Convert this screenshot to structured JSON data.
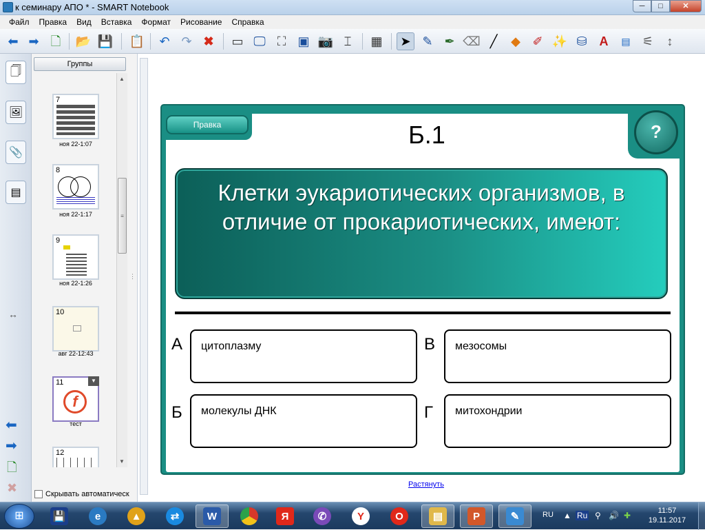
{
  "window": {
    "title": "к семинару АПО * - SMART Notebook",
    "minimize": "─",
    "maximize": "□",
    "close": "✕"
  },
  "menu": [
    "Файл",
    "Правка",
    "Вид",
    "Вставка",
    "Формат",
    "Рисование",
    "Справка"
  ],
  "toolbar_icons": [
    "back-arrow-icon",
    "forward-arrow-icon",
    "add-page-icon",
    "open-folder-icon",
    "save-icon",
    "paste-icon",
    "undo-icon",
    "redo-icon",
    "delete-icon",
    "screen-shade-icon",
    "show-screen-icon",
    "full-screen-icon",
    "dual-page-icon",
    "capture-icon",
    "table-icon",
    "select-icon",
    "pen-icon",
    "creative-pen-icon",
    "eraser-icon",
    "line-icon",
    "shapes-icon",
    "fill-icon",
    "magic-pen-icon",
    "fill-bucket-icon",
    "text-icon",
    "properties-icon",
    "measure-icon",
    "move-toolbar-icon"
  ],
  "sorter": {
    "groups_button": "Группы",
    "autohide_label": "Скрывать автоматическ",
    "pages": [
      {
        "number": "7",
        "caption": "ноя 22-1:07"
      },
      {
        "number": "8",
        "caption": "ноя 22-1:17"
      },
      {
        "number": "9",
        "caption": "ноя 22-1:26"
      },
      {
        "number": "10",
        "caption": "авг 22-12:43"
      },
      {
        "number": "11",
        "caption": "тест"
      },
      {
        "number": "12",
        "caption": ""
      }
    ]
  },
  "slide": {
    "edit_tab": "Правка",
    "help_symbol": "?",
    "title": "Б.1",
    "question": "Клетки эукариотических организмов, в отличие от прокариотических, имеют:",
    "answers": [
      {
        "letter": "А",
        "text": "цитоплазму"
      },
      {
        "letter": "В",
        "text": "мезосомы"
      },
      {
        "letter": "Б",
        "text": "молекулы ДНК"
      },
      {
        "letter": "Г",
        "text": "митохондрии"
      }
    ],
    "colors": {
      "frame": "#1a8e84",
      "question_dark": "#0c5f58",
      "question_light": "#24cdbd"
    }
  },
  "stretch_link": "Растянуть",
  "taskbar": {
    "apps": [
      "start-button",
      "smart-board-icon",
      "internet-explorer-icon",
      "aimp-icon",
      "teamviewer-icon",
      "word-icon",
      "chrome-icon",
      "yandex-icon",
      "viber-icon",
      "yandex-browser-icon",
      "opera-icon",
      "explorer-icon",
      "powerpoint-icon",
      "smart-notebook-icon"
    ],
    "language": "RU",
    "time": "11:57",
    "date": "19.11.2017"
  }
}
